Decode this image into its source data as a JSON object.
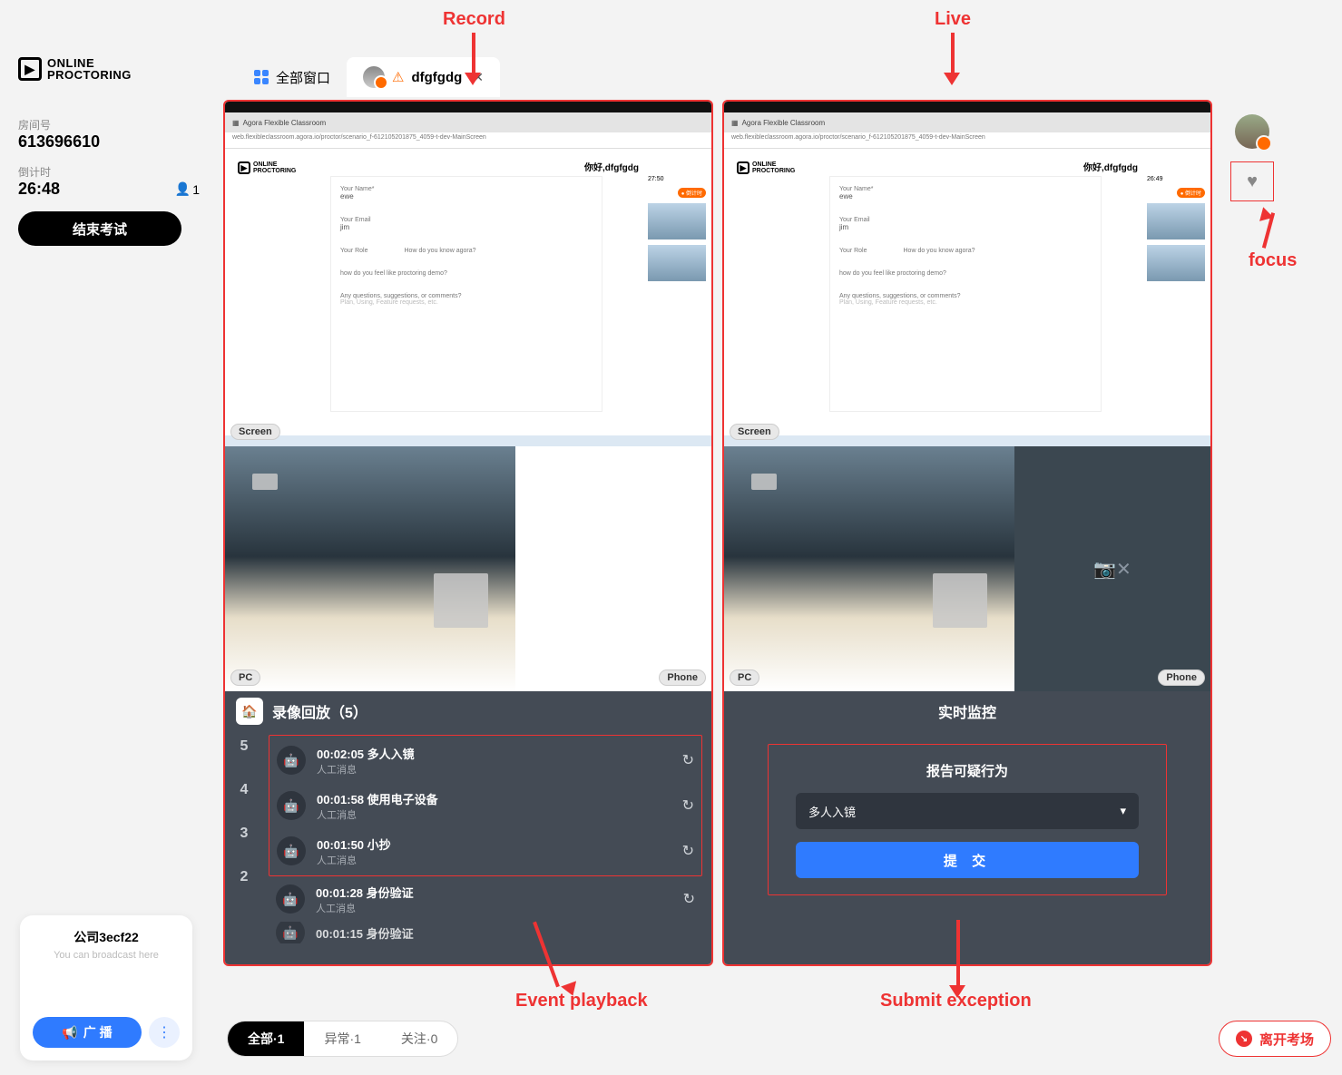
{
  "logo": "ONLINE\nPROCTORING",
  "room_label": "房间号",
  "room_id": "613696610",
  "countdown_label": "倒计时",
  "countdown": "26:48",
  "people_count": "1",
  "end_exam_btn": "结束考试",
  "tabs": {
    "all_windows": "全部窗口",
    "student": "dfgfgdg"
  },
  "screen": {
    "label": "Screen",
    "greeting": "你好,dfgfgdg",
    "url": "web.flexibleclassroom.agora.io/proctor/scenario_f-612105201875_4059-t-dev-MainScreen",
    "browser_tab": "Agora Flexible Classroom",
    "form": {
      "name_label": "Your Name*",
      "name_val": "ewe",
      "email_label": "Your Email",
      "email_val": "jim",
      "role_label": "Your Role",
      "know_label": "How do you know agora?",
      "q_label": "how do you feel like proctoring demo?",
      "sugg_label": "Any questions, suggestions, or comments?",
      "sugg_ph": "Plan, Using, Feature requests, etc."
    },
    "strip_time": "27:50"
  },
  "cam": {
    "pc": "PC",
    "phone": "Phone"
  },
  "record": {
    "header": "录像回放（5）",
    "events": [
      {
        "idx": "5",
        "time": "00:02:05",
        "title": "多人入镜",
        "sub": "人工消息"
      },
      {
        "idx": "4",
        "time": "00:01:58",
        "title": "使用电子设备",
        "sub": "人工消息"
      },
      {
        "idx": "3",
        "time": "00:01:50",
        "title": "小抄",
        "sub": "人工消息"
      },
      {
        "idx": "2",
        "time": "00:01:28",
        "title": "身份验证",
        "sub": "人工消息"
      }
    ],
    "more_time": "00:01:15",
    "more_title": "身份验证"
  },
  "live": {
    "header": "实时监控",
    "report_title": "报告可疑行为",
    "dropdown": "多人入镜",
    "submit": "提 交"
  },
  "filters": {
    "all": "全部·1",
    "abnormal": "异常·1",
    "followed": "关注·0"
  },
  "broadcast": {
    "title": "公司3ecf22",
    "placeholder": "You can broadcast here",
    "btn": "广 播"
  },
  "leave": "离开考场",
  "annotations": {
    "record": "Record",
    "live": "Live",
    "focus": "focus",
    "event_playback": "Event playback",
    "submit_exception": "Submit exception"
  }
}
